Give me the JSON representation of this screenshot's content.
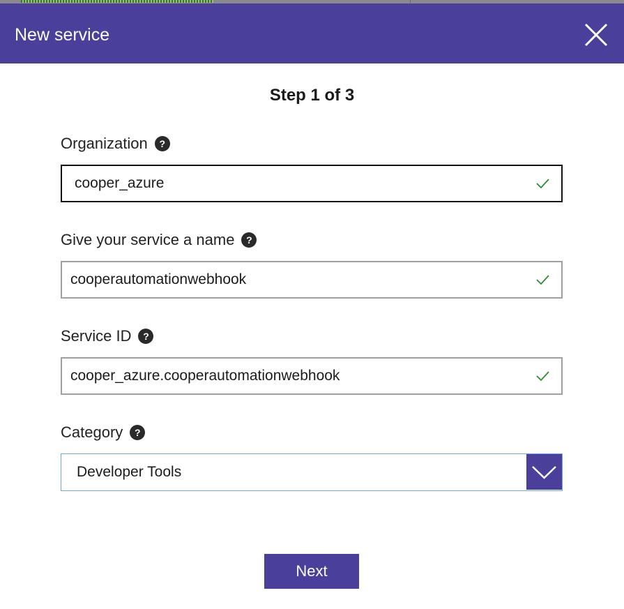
{
  "dialog": {
    "title": "New service",
    "step": "Step 1 of 3"
  },
  "fields": {
    "organization": {
      "label": "Organization",
      "value": "cooper_azure",
      "valid": true
    },
    "service_name": {
      "label": "Give your service a name",
      "value": "cooperautomationwebhook",
      "valid": true
    },
    "service_id": {
      "label": "Service ID",
      "value": "cooper_azure.cooperautomationwebhook",
      "valid": true
    },
    "category": {
      "label": "Category",
      "selected": "Developer Tools"
    }
  },
  "actions": {
    "next_label": "Next"
  },
  "icons": {
    "help": "question-mark-circle",
    "valid": "checkmark",
    "close": "x",
    "dropdown": "chevron-down"
  },
  "colors": {
    "brand": "#4a3f9b",
    "check": "#2e8b2e",
    "focus_border": "#111111",
    "select_border": "#6aa6e8"
  }
}
